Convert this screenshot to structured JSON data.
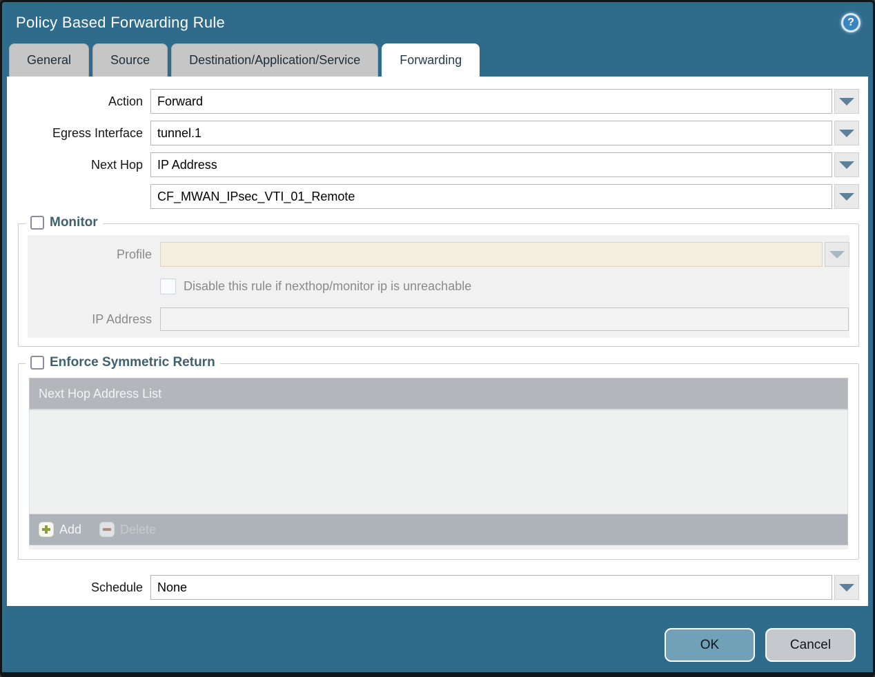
{
  "dialog": {
    "title": "Policy Based Forwarding Rule",
    "help_glyph": "?"
  },
  "tabs": [
    {
      "label": "General",
      "active": false
    },
    {
      "label": "Source",
      "active": false
    },
    {
      "label": "Destination/Application/Service",
      "active": false
    },
    {
      "label": "Forwarding",
      "active": true
    }
  ],
  "form": {
    "action": {
      "label": "Action",
      "value": "Forward"
    },
    "egress_interface": {
      "label": "Egress Interface",
      "value": "tunnel.1"
    },
    "next_hop": {
      "label": "Next Hop",
      "value": "IP Address"
    },
    "next_hop_address": {
      "value": "CF_MWAN_IPsec_VTI_01_Remote"
    },
    "schedule": {
      "label": "Schedule",
      "value": "None"
    }
  },
  "monitor": {
    "legend": "Monitor",
    "checked": false,
    "profile": {
      "label": "Profile",
      "value": ""
    },
    "disable_rule": {
      "label": "Disable this rule if nexthop/monitor ip is unreachable",
      "checked": false
    },
    "ip_address": {
      "label": "IP Address",
      "value": ""
    }
  },
  "symmetric_return": {
    "legend": "Enforce Symmetric Return",
    "checked": false,
    "table": {
      "header": "Next Hop Address List",
      "rows": []
    },
    "add_label": "Add",
    "delete_label": "Delete"
  },
  "footer": {
    "ok_label": "OK",
    "cancel_label": "Cancel"
  },
  "colors": {
    "dialog_background": "#2f6b8b",
    "active_tab_text": "#243c4d",
    "inactive_tab_background": "#c6c6c6",
    "legend_text": "#3f606f",
    "disabled_field_background": "#f3eedd",
    "table_header_background": "#b3b7bc",
    "ok_button_background": "#70a1b9",
    "cancel_button_background": "#c5c9cd",
    "dropdown_arrow": "#5d8199",
    "add_icon_green": "#8a9e3c",
    "delete_icon_red": "#b08a84"
  }
}
